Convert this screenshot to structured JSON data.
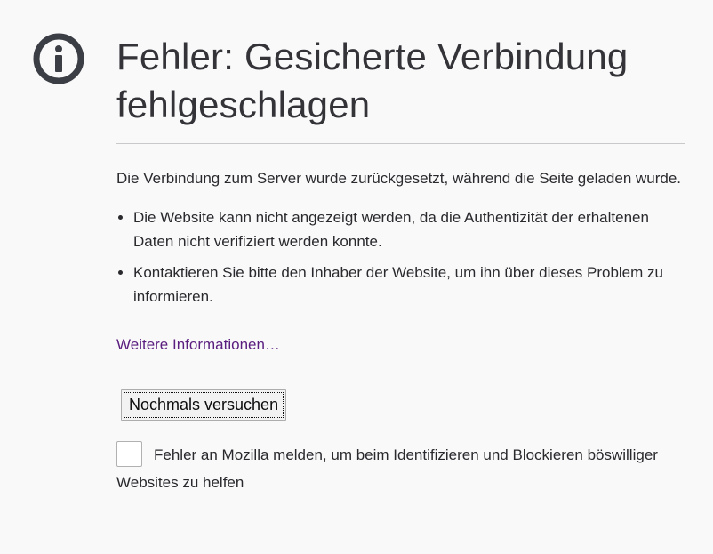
{
  "error": {
    "title": "Fehler: Gesicherte Verbindung fehlgeschlagen",
    "description": "Die Verbindung zum Server wurde zurückgesetzt, während die Seite geladen wurde.",
    "reasons": [
      "Die Website kann nicht angezeigt werden, da die Authentizität der erhaltenen Daten nicht verifiziert werden konnte.",
      "Kontaktieren Sie bitte den Inhaber der Website, um ihn über dieses Problem zu informieren."
    ],
    "learn_more_label": "Weitere Informationen…",
    "retry_label": "Nochmals versuchen",
    "report_label": "Fehler an Mozilla melden, um beim Identifizieren und Blockieren böswilliger Websites zu helfen"
  },
  "colors": {
    "background": "#f9f9fa",
    "title": "#333338",
    "link": "#5a1e7f",
    "icon": "#3b3f45"
  },
  "icon": "info-icon"
}
